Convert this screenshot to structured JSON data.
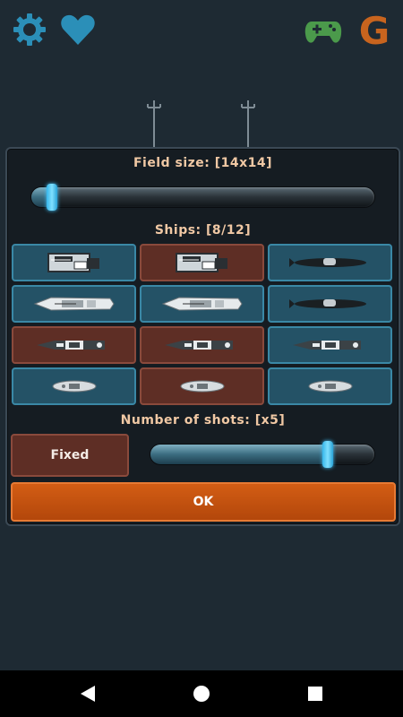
{
  "topbar": {
    "left_icons": [
      "gear-icon",
      "heart-icon"
    ],
    "right_icons": [
      "gamepad-icon",
      "g-logo-icon"
    ],
    "logo_letter": "G"
  },
  "dialog": {
    "field_size_label": "Field size: [14x14]",
    "field_size_slider_level": 0.06,
    "ships_label": "Ships: [8/12]",
    "ships": [
      {
        "type": "carrier",
        "selected": true
      },
      {
        "type": "carrier",
        "selected": false
      },
      {
        "type": "submarine",
        "selected": true
      },
      {
        "type": "battleship",
        "selected": true
      },
      {
        "type": "battleship",
        "selected": true
      },
      {
        "type": "submarine",
        "selected": true
      },
      {
        "type": "destroyer",
        "selected": false
      },
      {
        "type": "destroyer",
        "selected": false
      },
      {
        "type": "destroyer",
        "selected": true
      },
      {
        "type": "patrol-boat",
        "selected": true
      },
      {
        "type": "patrol-boat",
        "selected": false
      },
      {
        "type": "patrol-boat",
        "selected": true
      }
    ],
    "shots_label": "Number of shots: [x5]",
    "shots_slider_level": 0.79,
    "fixed_label": "Fixed",
    "ok_label": "OK"
  },
  "colors": {
    "background": "#1e2a33",
    "selected_cell": "#245266",
    "unselected_cell": "#5e2e25",
    "accent_orange": "#d35d14",
    "slider_thumb": "#37b6ea",
    "label_text": "#f0c8a4"
  },
  "navbar": {
    "buttons": [
      "back-icon",
      "home-icon",
      "recents-icon"
    ]
  }
}
